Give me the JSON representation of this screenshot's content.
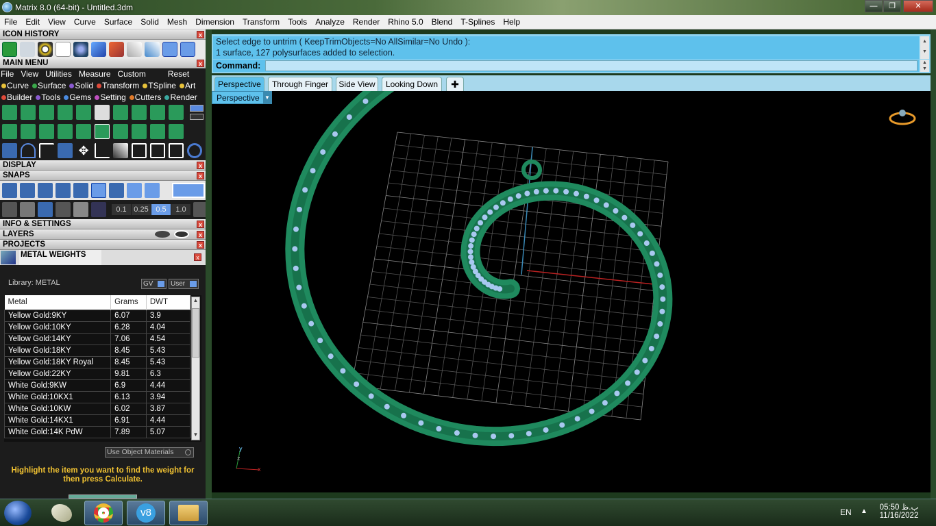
{
  "window": {
    "title": "Matrix 8.0 (64-bit) - Untitled.3dm"
  },
  "menubar": [
    "File",
    "Edit",
    "View",
    "Curve",
    "Surface",
    "Solid",
    "Mesh",
    "Dimension",
    "Transform",
    "Tools",
    "Analyze",
    "Render",
    "Rhino 5.0",
    "Blend",
    "T-Splines",
    "Help"
  ],
  "panels": {
    "icon_history": "ICON HISTORY",
    "main_menu": "MAIN MENU",
    "main_menu_bar": [
      "File",
      "View",
      "Utilities",
      "Measure",
      "Custom"
    ],
    "reset": "Reset",
    "cat_row1": [
      {
        "label": "Curve",
        "color": "#e8c23a"
      },
      {
        "label": "Surface",
        "color": "#3aa84a"
      },
      {
        "label": "Solid",
        "color": "#8a5ad0"
      },
      {
        "label": "Transform",
        "color": "#e04a3a"
      },
      {
        "label": "TSpline",
        "color": "#e8c23a"
      },
      {
        "label": "Art",
        "color": "#e8c23a"
      }
    ],
    "cat_row2": [
      {
        "label": "Builder",
        "color": "#e04a3a"
      },
      {
        "label": "Tools",
        "color": "#8a5ad0"
      },
      {
        "label": "Gems",
        "color": "#4a8ae0"
      },
      {
        "label": "Setting",
        "color": "#c050c0"
      },
      {
        "label": "Cutters",
        "color": "#e07a2a"
      },
      {
        "label": "Render",
        "color": "#3aa8a0"
      }
    ],
    "display": "DISPLAY",
    "snaps": "SNAPS",
    "snap_values": [
      "0.1",
      "0.25",
      "0.5",
      "1.0"
    ],
    "info_settings": "INFO & SETTINGS",
    "layers": "LAYERS",
    "projects": "PROJECTS",
    "metal_weights": "METAL WEIGHTS"
  },
  "metal_weights": {
    "library_label": "Library: METAL",
    "gv_btn": "GV",
    "user_btn": "User",
    "columns": [
      "Metal",
      "Grams",
      "DWT"
    ],
    "rows": [
      [
        "Yellow Gold:9KY",
        "6.07",
        "3.9"
      ],
      [
        "Yellow Gold:10KY",
        "6.28",
        "4.04"
      ],
      [
        "Yellow Gold:14KY",
        "7.06",
        "4.54"
      ],
      [
        "Yellow Gold:18KY",
        "8.45",
        "5.43"
      ],
      [
        "Yellow Gold:18KY Royal",
        "8.45",
        "5.43"
      ],
      [
        "Yellow Gold:22KY",
        "9.81",
        "6.3"
      ],
      [
        "White Gold:9KW",
        "6.9",
        "4.44"
      ],
      [
        "White Gold:10KX1",
        "6.13",
        "3.94"
      ],
      [
        "White Gold:10KW",
        "6.02",
        "3.87"
      ],
      [
        "White Gold:14KX1",
        "6.91",
        "4.44"
      ],
      [
        "White Gold:14K PdW",
        "7.89",
        "5.07"
      ]
    ],
    "use_object_materials": "Use Object Materials",
    "hint": "Highlight the item you want to find the weight for then press Calculate."
  },
  "command": {
    "history_line1": "Select edge to untrim ( KeepTrimObjects=No  AllSimilar=No  Undo ):",
    "history_line2": "1 surface, 127 polysurfaces added to selection.",
    "prompt": "Command:",
    "value": ""
  },
  "viewport_tabs": [
    "Perspective",
    "Through Finger",
    "Side View",
    "Looking Down"
  ],
  "active_tab": "Perspective",
  "viewport_label": "Perspective",
  "taskbar": {
    "lang": "EN",
    "time": "05:50 ب.ظ",
    "date": "11/16/2022"
  },
  "colors": {
    "model": "#1f8a5e",
    "stones": "#a9c8f0",
    "accent": "#5ec1ec"
  }
}
